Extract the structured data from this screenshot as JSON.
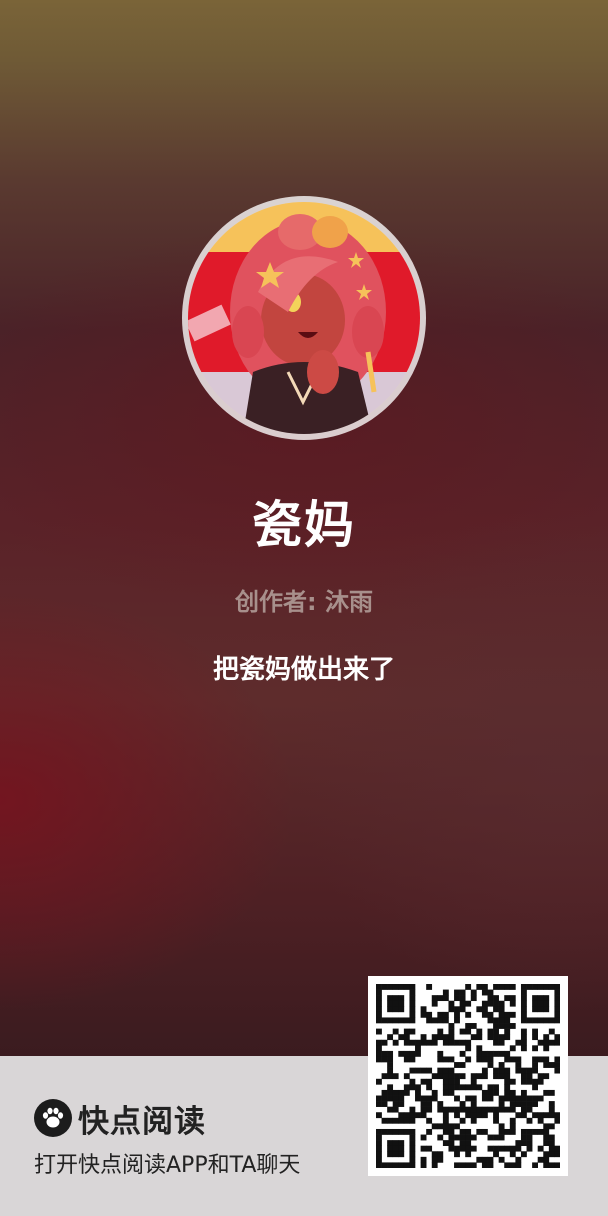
{
  "profile": {
    "name": "瓷妈",
    "creator": "创作者: 沐雨",
    "tagline": "把瓷妈做出来了"
  },
  "footer": {
    "brand_name": "快点阅读",
    "cta": "打开快点阅读APP和TA聊天"
  },
  "icons": {
    "brand": "paw-icon",
    "qr": "qr-code"
  },
  "colors": {
    "name_text": "#ffffff",
    "creator_text": "#a8908c",
    "footer_bg": "#d9d6d7",
    "avatar_red": "#e01a2a",
    "avatar_yellow": "#f6c25a"
  }
}
